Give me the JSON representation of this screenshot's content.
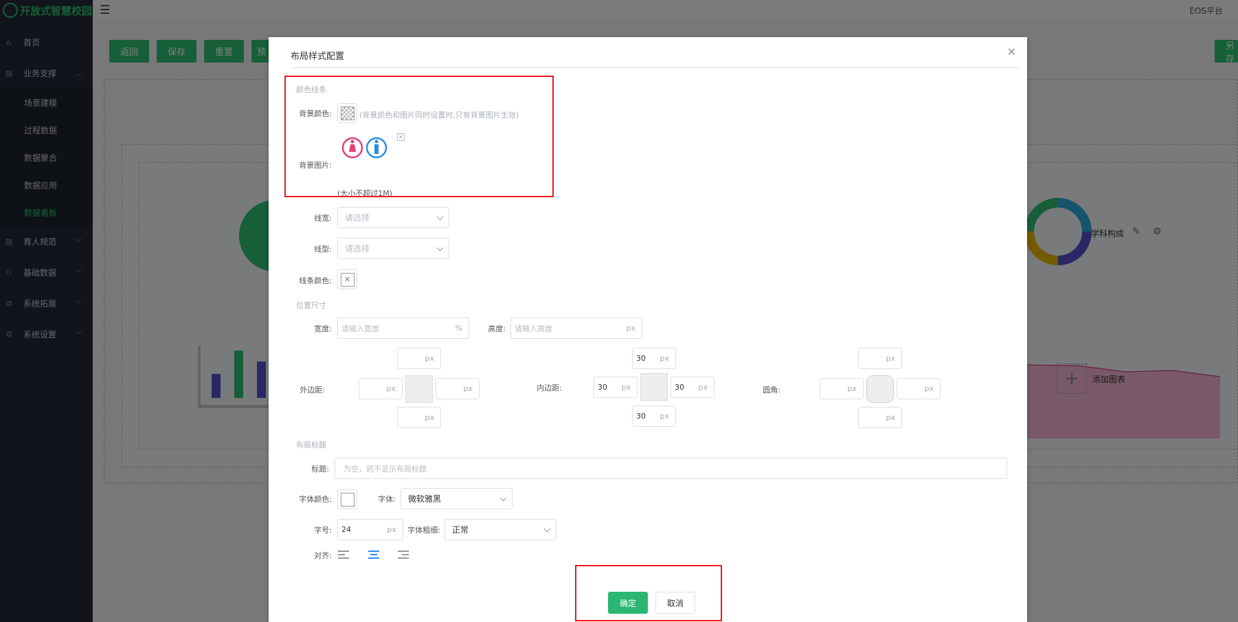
{
  "app": {
    "logo_text": "开放式智慧校园",
    "platform": "EOS平台"
  },
  "sidebar": {
    "items": [
      {
        "label": "首页",
        "icon": "home-icon"
      },
      {
        "label": "业务支撑",
        "icon": "monitor-icon",
        "expanded": true
      },
      {
        "label": "育人规范",
        "icon": "image-icon"
      },
      {
        "label": "基础数据",
        "icon": "users-icon"
      },
      {
        "label": "系统拓展",
        "icon": "extension-icon"
      },
      {
        "label": "系统设置",
        "icon": "gear-icon"
      }
    ],
    "sub_items": [
      "场景建模",
      "过程数据",
      "数据聚合",
      "数据应用",
      "数据看板"
    ],
    "active_sub": "数据看板"
  },
  "toolbar": {
    "back": "返回",
    "save": "保存",
    "reset": "重置",
    "preview_partial": "预",
    "other_partial": "另存"
  },
  "background": {
    "pie_label": "学科构成",
    "add_chart": "添加图表"
  },
  "dialog": {
    "title": "布局样式配置",
    "sections": {
      "color_line": "颜色线条",
      "position_size": "位置尺寸",
      "layout_title": "布局标题"
    },
    "bg_color_label": "背景颜色:",
    "bg_color_hint": "(背景颜色和图片同时设置时,只有背景图片生效)",
    "bg_image_label": "背景图片:",
    "bg_image_hint": "(大小不超过1M)",
    "line_width_label": "线宽:",
    "line_width_placeholder": "请选择",
    "line_type_label": "线型:",
    "line_type_placeholder": "请选择",
    "line_color_label": "线条颜色:",
    "width_label": "宽度:",
    "width_placeholder": "请输入宽度",
    "width_unit": "%",
    "height_label": "高度:",
    "height_placeholder": "请输入高度",
    "unit_px": "px",
    "margin_label": "外边距:",
    "padding_label": "内边距:",
    "radius_label": "圆角:",
    "padding_values": {
      "top": "30",
      "left": "30",
      "right": "30",
      "bottom": "30"
    },
    "title_label": "标题:",
    "title_placeholder": "为空，则不显示布局标题",
    "font_color_label": "字体颜色:",
    "font_label": "字体:",
    "font_value": "微软雅黑",
    "font_size_label": "字号:",
    "font_size_value": "24",
    "font_weight_label": "字体粗细:",
    "font_weight_value": "正常",
    "align_label": "对齐:",
    "align_selected": "center",
    "confirm": "确定",
    "cancel": "取消"
  },
  "colors": {
    "accent": "#2fbf71",
    "highlight": "#e81b1b",
    "sidebar_bg": "#232b36"
  }
}
